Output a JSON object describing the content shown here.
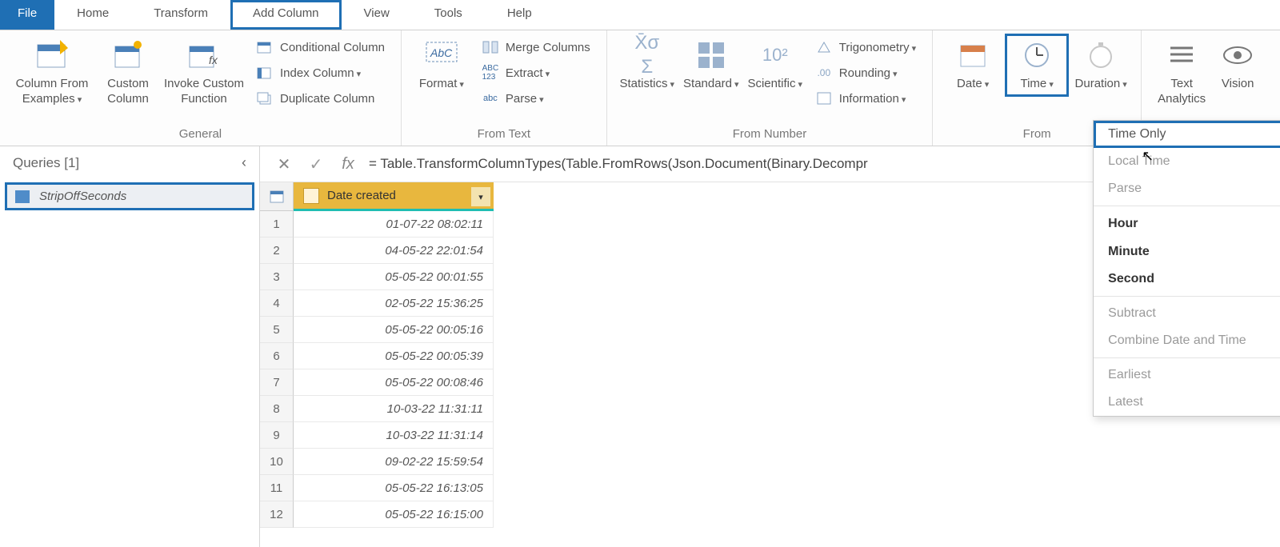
{
  "menubar": {
    "file": "File",
    "items": [
      "Home",
      "Transform",
      "Add Column",
      "View",
      "Tools",
      "Help"
    ],
    "active_index": 2
  },
  "ribbon": {
    "general": {
      "label": "General",
      "col_from_examples": "Column From Examples",
      "custom_column": "Custom Column",
      "invoke_custom_function": "Invoke Custom Function",
      "conditional_column": "Conditional Column",
      "index_column": "Index Column",
      "duplicate_column": "Duplicate Column"
    },
    "from_text": {
      "label": "From Text",
      "format": "Format",
      "merge_columns": "Merge Columns",
      "extract": "Extract",
      "parse": "Parse"
    },
    "from_number": {
      "label": "From Number",
      "statistics": "Statistics",
      "standard": "Standard",
      "scientific": "Scientific",
      "trigonometry": "Trigonometry",
      "rounding": "Rounding",
      "information": "Information"
    },
    "from_datetime": {
      "label_partial": "From",
      "date": "Date",
      "time": "Time",
      "duration": "Duration"
    },
    "ai": {
      "text_analytics": "Text Analytics",
      "vision": "Vision"
    }
  },
  "queries": {
    "header": "Queries [1]",
    "items": [
      "StripOffSeconds"
    ]
  },
  "formula_bar": {
    "text": "= Table.TransformColumnTypes(Table.FromRows(Json.Document(Binary.Decompr"
  },
  "grid": {
    "column_header": "Date created",
    "rows": [
      {
        "n": "1",
        "v": "01-07-22 08:02:11"
      },
      {
        "n": "2",
        "v": "04-05-22 22:01:54"
      },
      {
        "n": "3",
        "v": "05-05-22 00:01:55"
      },
      {
        "n": "4",
        "v": "02-05-22 15:36:25"
      },
      {
        "n": "5",
        "v": "05-05-22 00:05:16"
      },
      {
        "n": "6",
        "v": "05-05-22 00:05:39"
      },
      {
        "n": "7",
        "v": "05-05-22 00:08:46"
      },
      {
        "n": "8",
        "v": "10-03-22 11:31:11"
      },
      {
        "n": "9",
        "v": "10-03-22 11:31:14"
      },
      {
        "n": "10",
        "v": "09-02-22 15:59:54"
      },
      {
        "n": "11",
        "v": "05-05-22 16:13:05"
      },
      {
        "n": "12",
        "v": "05-05-22 16:15:00"
      }
    ]
  },
  "time_menu": {
    "time_only": "Time Only",
    "local_time": "Local Time",
    "parse": "Parse",
    "hour": "Hour",
    "minute": "Minute",
    "second": "Second",
    "subtract": "Subtract",
    "combine": "Combine Date and Time",
    "earliest": "Earliest",
    "latest": "Latest"
  }
}
